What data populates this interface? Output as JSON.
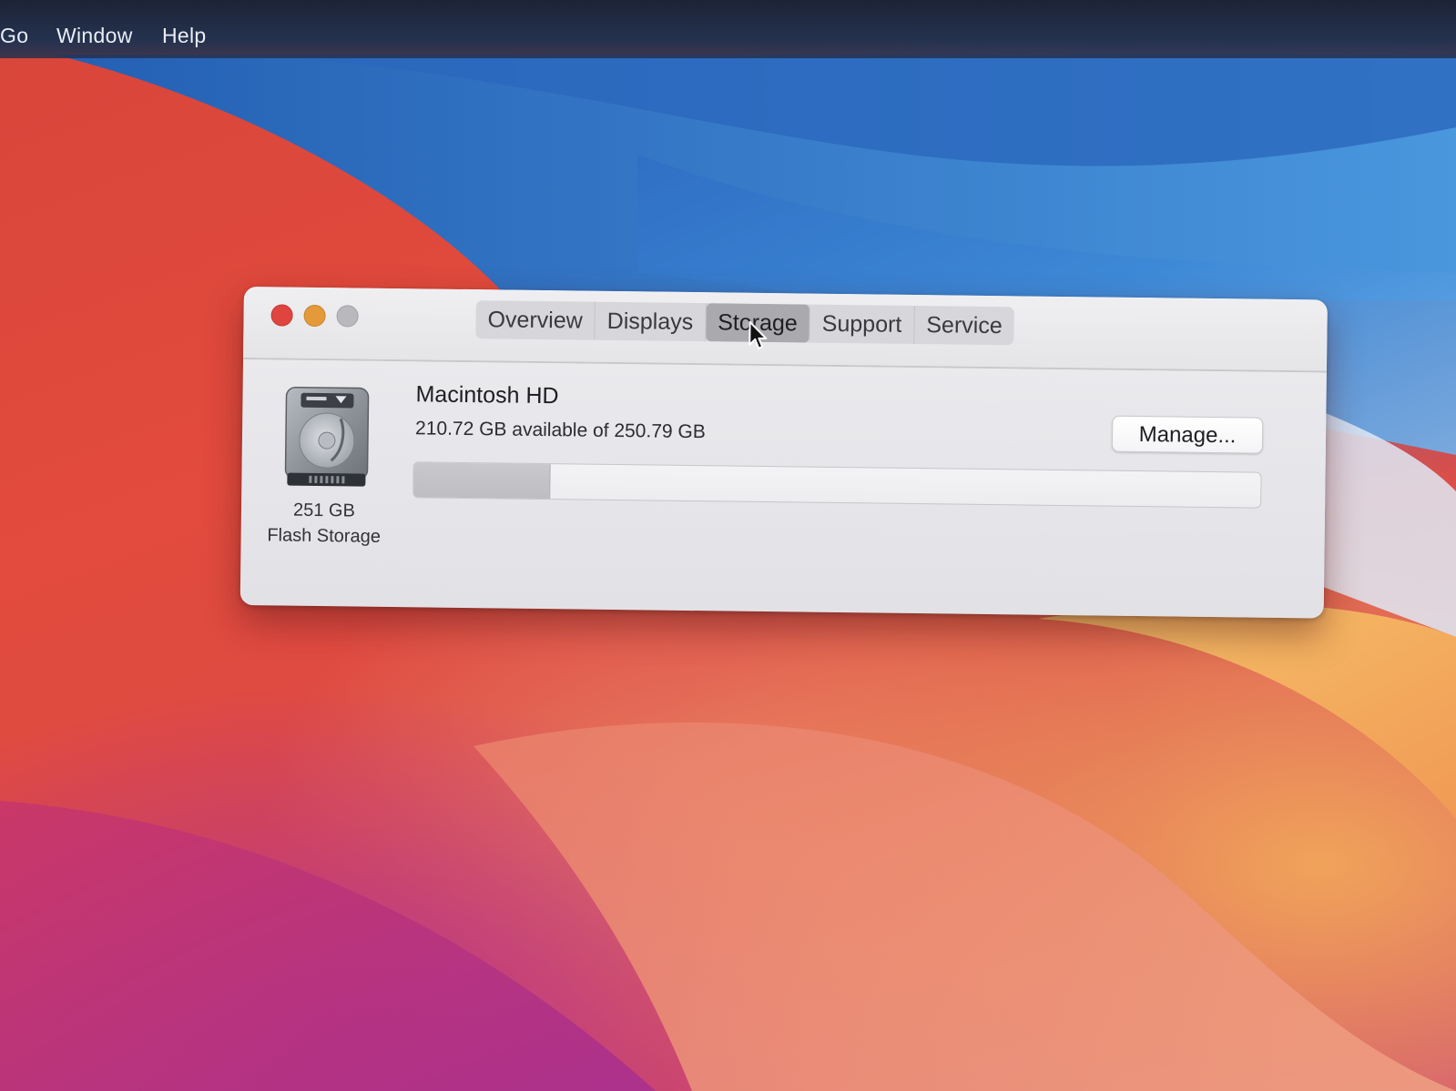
{
  "menubar": {
    "items": [
      "Go",
      "Window",
      "Help"
    ]
  },
  "window": {
    "traffic_lights": {
      "close_color": "#e0443e",
      "minimize_color": "#e49a3a",
      "zoom_color": "#b5b5b9"
    },
    "tabs": [
      {
        "label": "Overview",
        "active": false
      },
      {
        "label": "Displays",
        "active": false
      },
      {
        "label": "Storage",
        "active": true
      },
      {
        "label": "Support",
        "active": false
      },
      {
        "label": "Service",
        "active": false
      }
    ],
    "disk": {
      "icon": "hard-drive-icon",
      "size_label": "251 GB",
      "type_label": "Flash Storage"
    },
    "volume": {
      "name": "Macintosh HD",
      "availability": "210.72 GB available of 250.79 GB",
      "used_fraction": 0.16
    },
    "manage_label": "Manage..."
  },
  "cursor": "arrow-cursor-icon",
  "colors": {
    "wallpaper_red": "#dc4a45",
    "wallpaper_blue": "#3f86d4",
    "wallpaper_orange": "#f1a35a",
    "menubar": "#1c2336"
  }
}
